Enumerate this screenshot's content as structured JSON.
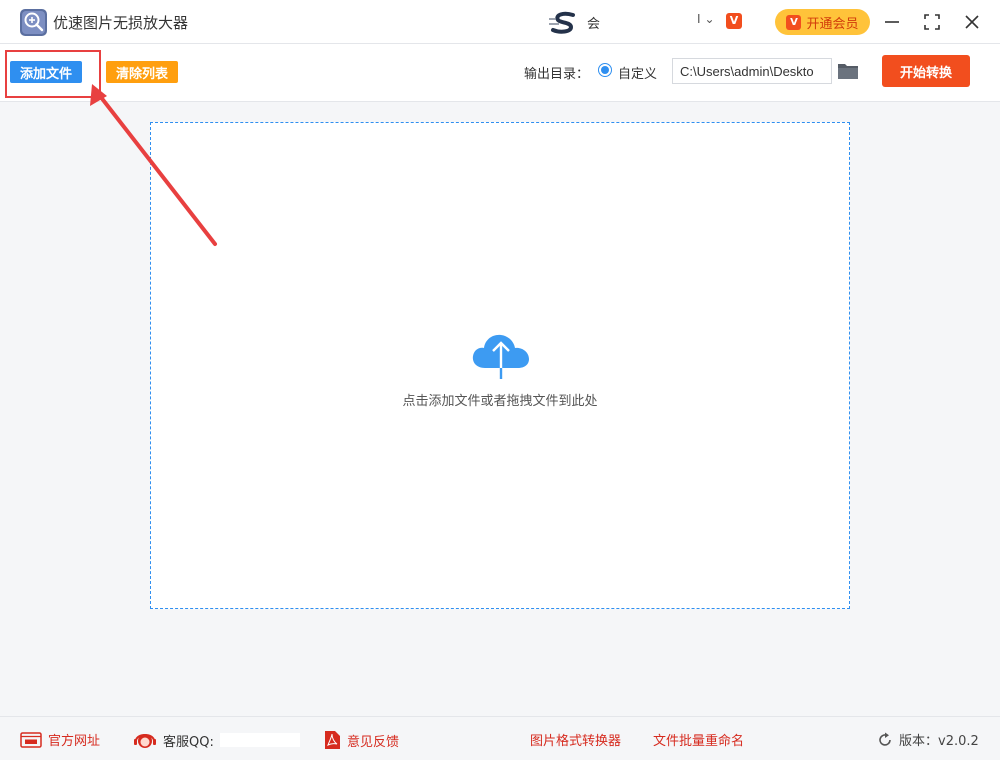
{
  "app": {
    "title": "优速图片无损放大器",
    "user_name": "会",
    "user_menu": "I",
    "vip_button": "开通会员"
  },
  "toolbar": {
    "add_files": "添加文件",
    "clear_list": "清除列表",
    "output_label": "输出目录：",
    "radio_custom": "自定义",
    "output_path": "C:\\Users\\admin\\Deskto",
    "start": "开始转换"
  },
  "dropzone": {
    "hint": "点击添加文件或者拖拽文件到此处"
  },
  "footer": {
    "site": "官方网址",
    "qq": "客服QQ:",
    "feedback": "意见反馈",
    "converter": "图片格式转换器",
    "rename": "文件批量重命名",
    "version": "版本：v2.0.2"
  },
  "colors": {
    "primary": "#2f8ff0",
    "clear": "#ff9f0f",
    "start": "#f24e1e",
    "vip": "#ffc33a",
    "annotation": "#e84040",
    "footer_link": "#d62b1f"
  },
  "icons": [
    "magnifier-plus-icon",
    "brand-logo-icon",
    "vip-icon",
    "minimize-icon",
    "maximize-icon",
    "close-icon",
    "folder-icon",
    "cloud-upload-icon",
    "website-icon",
    "support-icon",
    "pdf-feedback-icon",
    "refresh-icon"
  ]
}
